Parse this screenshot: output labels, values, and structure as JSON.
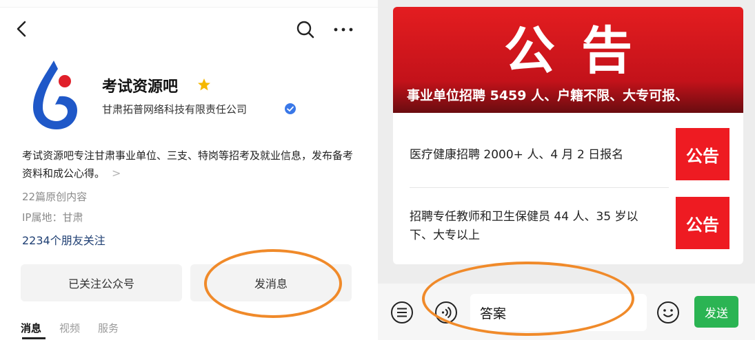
{
  "profile": {
    "account_name": "考试资源吧",
    "company": "甘肃拓普网络科技有限责任公司",
    "description": "考试资源吧专注甘肃事业单位、三支、特岗等招考及就业信息，发布备考资料和成公心得。",
    "desc_more": ">",
    "original_count": "22篇原创内容",
    "ip_location": "IP属地：甘肃",
    "followers": "2234个朋友关注"
  },
  "actions": {
    "followed_label": "已关注公众号",
    "message_label": "发消息"
  },
  "tabs": [
    {
      "label": "消息"
    },
    {
      "label": "视频"
    },
    {
      "label": "服务"
    }
  ],
  "article": {
    "banner_title": "公告",
    "banner_subtitle": "事业单位招聘 5459 人、户籍不限、大专可报、",
    "items": [
      {
        "text": "医疗健康招聘 2000+ 人、4 月 2 日报名",
        "thumb": "公告"
      },
      {
        "text": "招聘专任教师和卫生保健员 44 人、35 岁以下、大专以上",
        "thumb": "公告"
      }
    ]
  },
  "input": {
    "value": "答案",
    "send_label": "发送"
  },
  "colors": {
    "highlight": "#f08a2a",
    "banner_red": "#e41d20",
    "send_green": "#2bb453",
    "link_blue": "#1f3f73"
  },
  "icons": [
    "back-icon",
    "search-icon",
    "more-icon",
    "star-icon",
    "verified-icon",
    "menu-icon",
    "voice-icon",
    "emoji-icon"
  ]
}
